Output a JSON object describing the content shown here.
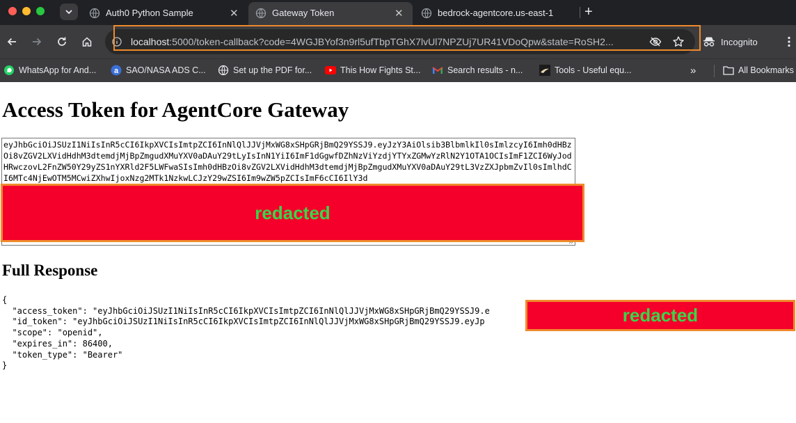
{
  "tabs": [
    {
      "title": "Auth0 Python Sample",
      "active": false
    },
    {
      "title": "Gateway Token",
      "active": true
    },
    {
      "title": "bedrock-agentcore.us-east-1",
      "active": false
    }
  ],
  "toolbar": {
    "url_host": "localhost",
    "url_rest": ":5000/token-callback?code=4WGJBYof3n9rl5ufTbpTGhX7lvUl7NPZUj7UR41VDoQpw&state=RoSH2...",
    "incognito_label": "Incognito"
  },
  "bookmarks": {
    "items": [
      {
        "label": "WhatsApp for And..."
      },
      {
        "label": "SAO/NASA ADS C..."
      },
      {
        "label": "Set up the PDF for..."
      },
      {
        "label": "This How Fights St..."
      },
      {
        "label": "Search results - n..."
      },
      {
        "label": "Tools - Useful equ..."
      }
    ],
    "overflow_label": "»",
    "all_bookmarks_label": "All Bookmarks"
  },
  "page": {
    "title": "Access Token for AgentCore Gateway",
    "token_text": "eyJhbGciOiJSUzI1NiIsInR5cCI6IkpXVCIsImtpZCI6InNlQlJJVjMxWG8xSHpGRjBmQ29YSSJ9.eyJzY3AiOlsib3BlbmlkIl0sImlzcyI6Imh0dHBzOi8vZGV2LXVidHdhM3dtemdjMjBpZmgudXMuYXV0aDAuY29tLyIsInN1YiI6ImF1dGgwfDZhNzViYzdjYTYxZGMwYzRlN2Y1OTA1OCIsImF1ZCI6WyJodHRwczovL2FnZW50Y29yZS1nYXRld2F5LWFwaSIsImh0dHBzOi8vZGV2LXVidHdhM3dtemdjMjBpZmgudXMuYXV0aDAuY29tL3VzZXJpbmZvIl0sImlhdCI6MTc4NjEwOTM5MCwiZXhwIjoxNzg2MTk1NzkwLCJzY29wZSI6Im9wZW5pZCIsImF6cCI6IlY3d",
    "redacted_label": "redacted",
    "subtitle": "Full Response",
    "response_lines": [
      "{",
      "  \"access_token\": \"eyJhbGciOiJSUzI1NiIsInR5cCI6IkpXVCIsImtpZCI6InNlQlJJVjMxWG8xSHpGRjBmQ29YSSJ9.e",
      "  \"id_token\": \"eyJhbGciOiJSUzI1NiIsInR5cCI6IkpXVCIsImtpZCI6InNlQlJJVjMxWG8xSHpGRjBmQ29YSSJ9.eyJp",
      "  \"scope\": \"openid\",",
      "  \"expires_in\": 86400,",
      "  \"token_type\": \"Bearer\"",
      "}"
    ]
  },
  "colors": {
    "redact_fill": "#f5002a",
    "redact_border": "#f08a2c",
    "redact_text": "#38d64a"
  }
}
